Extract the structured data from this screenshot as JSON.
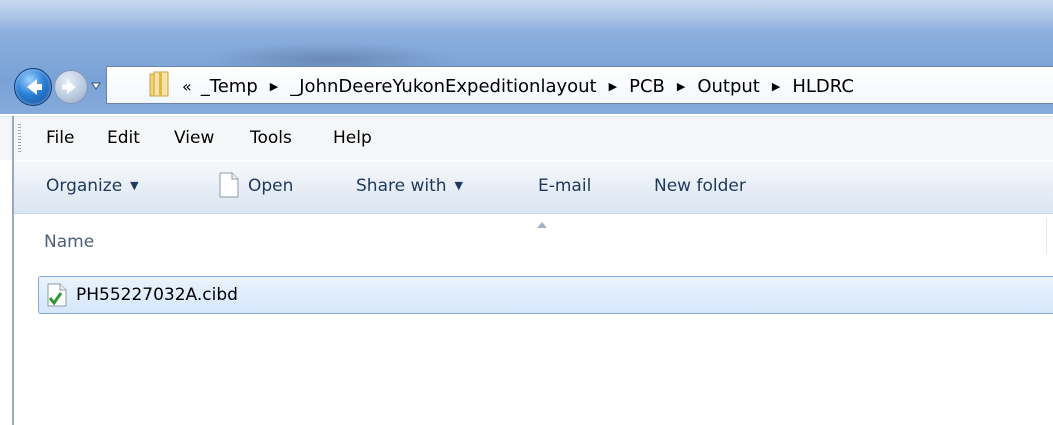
{
  "window": {
    "breadcrumb": {
      "overflow_chevron": "«",
      "items": [
        "_Temp",
        "_JohnDeereYukonExpeditionlayout",
        "PCB",
        "Output",
        "HLDRC"
      ]
    }
  },
  "menu": {
    "items": [
      "File",
      "Edit",
      "View",
      "Tools",
      "Help"
    ]
  },
  "toolbar": {
    "organize_label": "Organize",
    "open_label": "Open",
    "share_label": "Share with",
    "email_label": "E-mail",
    "new_folder_label": "New folder"
  },
  "content": {
    "columns": [
      "Name"
    ],
    "files": [
      {
        "name": "PH55227032A.cibd",
        "icon": "document-check-icon",
        "selected": true
      }
    ]
  },
  "colors": {
    "accent": "#1e395b",
    "selection_fill": "#d5e7fb",
    "selection_border": "#84acdd"
  }
}
